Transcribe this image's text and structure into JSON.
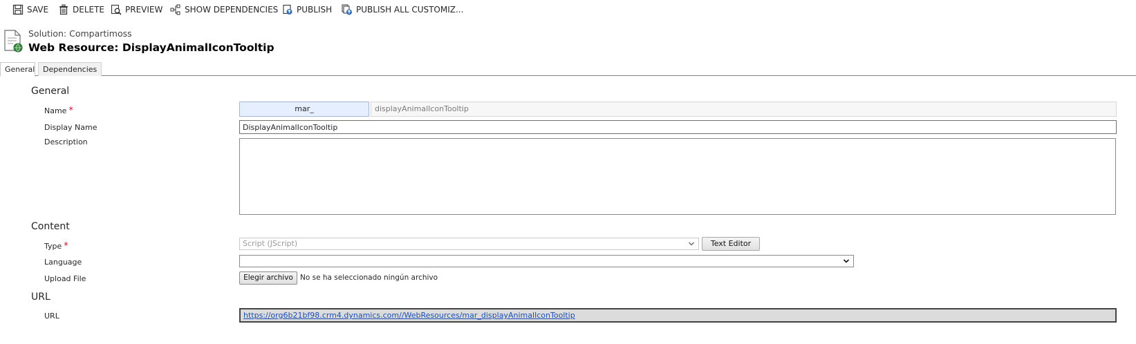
{
  "toolbar": {
    "save": "SAVE",
    "delete": "DELETE",
    "preview": "PREVIEW",
    "show_dependencies": "SHOW DEPENDENCIES",
    "publish": "PUBLISH",
    "publish_all": "PUBLISH ALL CUSTOMIZ..."
  },
  "header": {
    "solution": "Solution: Compartimoss",
    "title": "Web Resource: DisplayAnimalIconTooltip"
  },
  "tabs": [
    {
      "label": "General",
      "active": true
    },
    {
      "label": "Dependencies",
      "active": false
    }
  ],
  "general": {
    "section_title": "General",
    "name_label": "Name",
    "name_prefix": "mar_",
    "name_value": "displayAnimalIconTooltip",
    "display_name_label": "Display Name",
    "display_name_value": "DisplayAnimalIconTooltip",
    "description_label": "Description",
    "description_value": ""
  },
  "content": {
    "section_title": "Content",
    "type_label": "Type",
    "type_value": "Script (JScript)",
    "text_editor_button": "Text Editor",
    "language_label": "Language",
    "language_value": "",
    "upload_label": "Upload File",
    "choose_file_button": "Elegir archivo",
    "no_file_text": "No se ha seleccionado ningún archivo"
  },
  "url": {
    "section_title": "URL",
    "url_label": "URL",
    "url_value": "https://org6b21bf98.crm4.dynamics.com//WebResources/mar_displayAnimalIconTooltip"
  },
  "required_marker": "*",
  "colors": {
    "required": "#c8102e",
    "link": "#1b4fb4",
    "prefix_bg": "#e6efff"
  }
}
